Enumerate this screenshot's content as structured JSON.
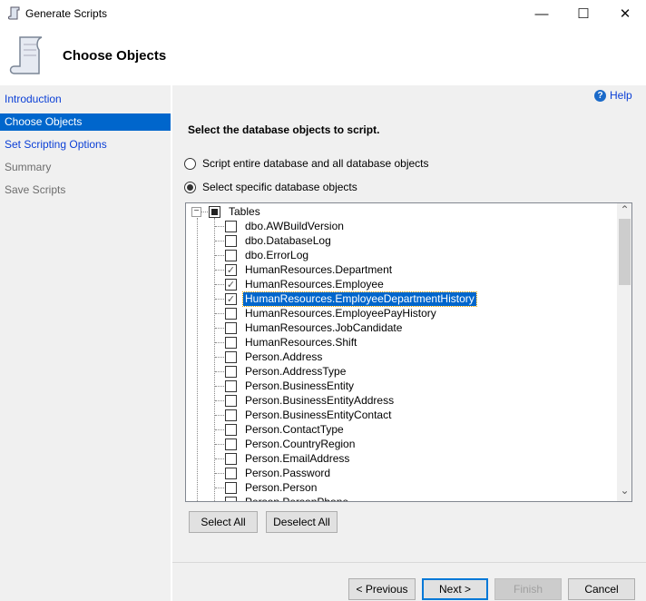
{
  "window": {
    "title": "Generate Scripts",
    "minimize": "—",
    "maximize": "☐",
    "close": "✕"
  },
  "header": {
    "title": "Choose Objects",
    "icon": "scroll-icon"
  },
  "nav": {
    "items": [
      {
        "label": "Introduction",
        "state": "link"
      },
      {
        "label": "Choose Objects",
        "state": "selected"
      },
      {
        "label": "Set Scripting Options",
        "state": "link"
      },
      {
        "label": "Summary",
        "state": "disabled"
      },
      {
        "label": "Save Scripts",
        "state": "disabled"
      }
    ]
  },
  "help": {
    "label": "Help",
    "icon": "?"
  },
  "main": {
    "instruction": "Select the database objects to script.",
    "radio_entire": "Script entire database and all database objects",
    "radio_specific": "Select specific database objects",
    "selected_option": "specific"
  },
  "tree": {
    "root": {
      "label": "Tables",
      "expander": "−",
      "state": "indeterminate"
    },
    "items": [
      {
        "label": "dbo.AWBuildVersion",
        "checked": false
      },
      {
        "label": "dbo.DatabaseLog",
        "checked": false
      },
      {
        "label": "dbo.ErrorLog",
        "checked": false
      },
      {
        "label": "HumanResources.Department",
        "checked": true
      },
      {
        "label": "HumanResources.Employee",
        "checked": true
      },
      {
        "label": "HumanResources.EmployeeDepartmentHistory",
        "checked": true,
        "selected": true
      },
      {
        "label": "HumanResources.EmployeePayHistory",
        "checked": false
      },
      {
        "label": "HumanResources.JobCandidate",
        "checked": false
      },
      {
        "label": "HumanResources.Shift",
        "checked": false
      },
      {
        "label": "Person.Address",
        "checked": false
      },
      {
        "label": "Person.AddressType",
        "checked": false
      },
      {
        "label": "Person.BusinessEntity",
        "checked": false
      },
      {
        "label": "Person.BusinessEntityAddress",
        "checked": false
      },
      {
        "label": "Person.BusinessEntityContact",
        "checked": false
      },
      {
        "label": "Person.ContactType",
        "checked": false
      },
      {
        "label": "Person.CountryRegion",
        "checked": false
      },
      {
        "label": "Person.EmailAddress",
        "checked": false
      },
      {
        "label": "Person.Password",
        "checked": false
      },
      {
        "label": "Person.Person",
        "checked": false
      },
      {
        "label": "Person.PersonPhone",
        "checked": false
      }
    ]
  },
  "buttons": {
    "select_all": "Select All",
    "deselect_all": "Deselect All",
    "previous": "< Previous",
    "next": "Next >",
    "finish": "Finish",
    "cancel": "Cancel"
  },
  "scroll": {
    "up": "⌃",
    "down": "⌄"
  }
}
